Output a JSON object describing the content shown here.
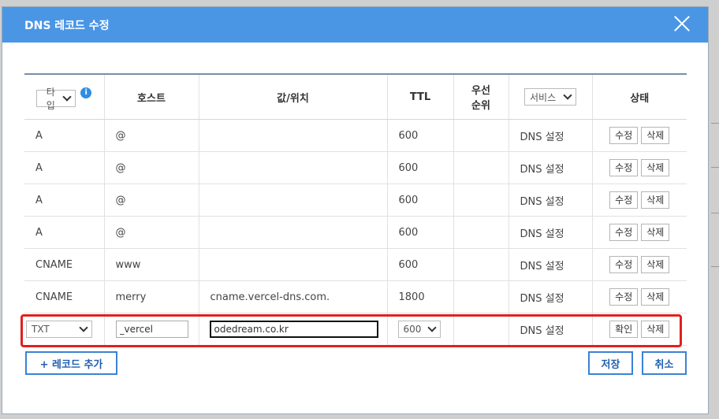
{
  "dialog": {
    "title": "DNS 레코드 수정"
  },
  "columns": {
    "type": "타입",
    "host": "호스트",
    "value": "값/위치",
    "ttl": "TTL",
    "priority_line1": "우선",
    "priority_line2": "순위",
    "service": "서비스",
    "state": "상태"
  },
  "rows": [
    {
      "type": "A",
      "host": "@",
      "value": "",
      "ttl": "600",
      "priority": "",
      "service": "DNS 설정",
      "edit": "수정",
      "delete": "삭제"
    },
    {
      "type": "A",
      "host": "@",
      "value": "",
      "ttl": "600",
      "priority": "",
      "service": "DNS 설정",
      "edit": "수정",
      "delete": "삭제"
    },
    {
      "type": "A",
      "host": "@",
      "value": "",
      "ttl": "600",
      "priority": "",
      "service": "DNS 설정",
      "edit": "수정",
      "delete": "삭제"
    },
    {
      "type": "A",
      "host": "@",
      "value": "",
      "ttl": "600",
      "priority": "",
      "service": "DNS 설정",
      "edit": "수정",
      "delete": "삭제"
    },
    {
      "type": "CNAME",
      "host": "www",
      "value": "",
      "ttl": "600",
      "priority": "",
      "service": "DNS 설정",
      "edit": "수정",
      "delete": "삭제"
    },
    {
      "type": "CNAME",
      "host": "merry",
      "value": "cname.vercel-dns.com.",
      "ttl": "1800",
      "priority": "",
      "service": "DNS 설정",
      "edit": "수정",
      "delete": "삭제"
    }
  ],
  "edit_row": {
    "type": "TXT",
    "host": "_vercel",
    "value": "odedream.co.kr",
    "ttl": "600",
    "service": "DNS 설정",
    "confirm": "확인",
    "delete": "삭제"
  },
  "footer": {
    "add_record": "+ 레코드 추가",
    "save": "저장",
    "cancel": "취소"
  },
  "colors": {
    "header": "#4a96e5",
    "highlight": "#e02020",
    "button_border": "#3b82d3"
  }
}
